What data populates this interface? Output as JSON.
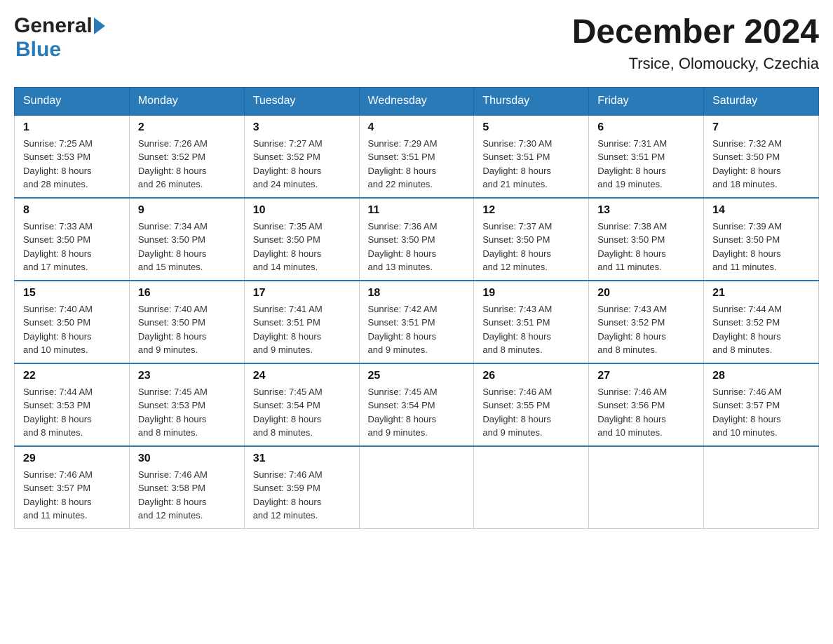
{
  "header": {
    "logo_general": "General",
    "logo_blue": "Blue",
    "month_title": "December 2024",
    "location": "Trsice, Olomoucky, Czechia"
  },
  "days_of_week": [
    "Sunday",
    "Monday",
    "Tuesday",
    "Wednesday",
    "Thursday",
    "Friday",
    "Saturday"
  ],
  "weeks": [
    [
      {
        "day": "1",
        "sunrise": "7:25 AM",
        "sunset": "3:53 PM",
        "daylight": "8 hours and 28 minutes."
      },
      {
        "day": "2",
        "sunrise": "7:26 AM",
        "sunset": "3:52 PM",
        "daylight": "8 hours and 26 minutes."
      },
      {
        "day": "3",
        "sunrise": "7:27 AM",
        "sunset": "3:52 PM",
        "daylight": "8 hours and 24 minutes."
      },
      {
        "day": "4",
        "sunrise": "7:29 AM",
        "sunset": "3:51 PM",
        "daylight": "8 hours and 22 minutes."
      },
      {
        "day": "5",
        "sunrise": "7:30 AM",
        "sunset": "3:51 PM",
        "daylight": "8 hours and 21 minutes."
      },
      {
        "day": "6",
        "sunrise": "7:31 AM",
        "sunset": "3:51 PM",
        "daylight": "8 hours and 19 minutes."
      },
      {
        "day": "7",
        "sunrise": "7:32 AM",
        "sunset": "3:50 PM",
        "daylight": "8 hours and 18 minutes."
      }
    ],
    [
      {
        "day": "8",
        "sunrise": "7:33 AM",
        "sunset": "3:50 PM",
        "daylight": "8 hours and 17 minutes."
      },
      {
        "day": "9",
        "sunrise": "7:34 AM",
        "sunset": "3:50 PM",
        "daylight": "8 hours and 15 minutes."
      },
      {
        "day": "10",
        "sunrise": "7:35 AM",
        "sunset": "3:50 PM",
        "daylight": "8 hours and 14 minutes."
      },
      {
        "day": "11",
        "sunrise": "7:36 AM",
        "sunset": "3:50 PM",
        "daylight": "8 hours and 13 minutes."
      },
      {
        "day": "12",
        "sunrise": "7:37 AM",
        "sunset": "3:50 PM",
        "daylight": "8 hours and 12 minutes."
      },
      {
        "day": "13",
        "sunrise": "7:38 AM",
        "sunset": "3:50 PM",
        "daylight": "8 hours and 11 minutes."
      },
      {
        "day": "14",
        "sunrise": "7:39 AM",
        "sunset": "3:50 PM",
        "daylight": "8 hours and 11 minutes."
      }
    ],
    [
      {
        "day": "15",
        "sunrise": "7:40 AM",
        "sunset": "3:50 PM",
        "daylight": "8 hours and 10 minutes."
      },
      {
        "day": "16",
        "sunrise": "7:40 AM",
        "sunset": "3:50 PM",
        "daylight": "8 hours and 9 minutes."
      },
      {
        "day": "17",
        "sunrise": "7:41 AM",
        "sunset": "3:51 PM",
        "daylight": "8 hours and 9 minutes."
      },
      {
        "day": "18",
        "sunrise": "7:42 AM",
        "sunset": "3:51 PM",
        "daylight": "8 hours and 9 minutes."
      },
      {
        "day": "19",
        "sunrise": "7:43 AM",
        "sunset": "3:51 PM",
        "daylight": "8 hours and 8 minutes."
      },
      {
        "day": "20",
        "sunrise": "7:43 AM",
        "sunset": "3:52 PM",
        "daylight": "8 hours and 8 minutes."
      },
      {
        "day": "21",
        "sunrise": "7:44 AM",
        "sunset": "3:52 PM",
        "daylight": "8 hours and 8 minutes."
      }
    ],
    [
      {
        "day": "22",
        "sunrise": "7:44 AM",
        "sunset": "3:53 PM",
        "daylight": "8 hours and 8 minutes."
      },
      {
        "day": "23",
        "sunrise": "7:45 AM",
        "sunset": "3:53 PM",
        "daylight": "8 hours and 8 minutes."
      },
      {
        "day": "24",
        "sunrise": "7:45 AM",
        "sunset": "3:54 PM",
        "daylight": "8 hours and 8 minutes."
      },
      {
        "day": "25",
        "sunrise": "7:45 AM",
        "sunset": "3:54 PM",
        "daylight": "8 hours and 9 minutes."
      },
      {
        "day": "26",
        "sunrise": "7:46 AM",
        "sunset": "3:55 PM",
        "daylight": "8 hours and 9 minutes."
      },
      {
        "day": "27",
        "sunrise": "7:46 AM",
        "sunset": "3:56 PM",
        "daylight": "8 hours and 10 minutes."
      },
      {
        "day": "28",
        "sunrise": "7:46 AM",
        "sunset": "3:57 PM",
        "daylight": "8 hours and 10 minutes."
      }
    ],
    [
      {
        "day": "29",
        "sunrise": "7:46 AM",
        "sunset": "3:57 PM",
        "daylight": "8 hours and 11 minutes."
      },
      {
        "day": "30",
        "sunrise": "7:46 AM",
        "sunset": "3:58 PM",
        "daylight": "8 hours and 12 minutes."
      },
      {
        "day": "31",
        "sunrise": "7:46 AM",
        "sunset": "3:59 PM",
        "daylight": "8 hours and 12 minutes."
      },
      null,
      null,
      null,
      null
    ]
  ],
  "labels": {
    "sunrise": "Sunrise:",
    "sunset": "Sunset:",
    "daylight": "Daylight:"
  }
}
